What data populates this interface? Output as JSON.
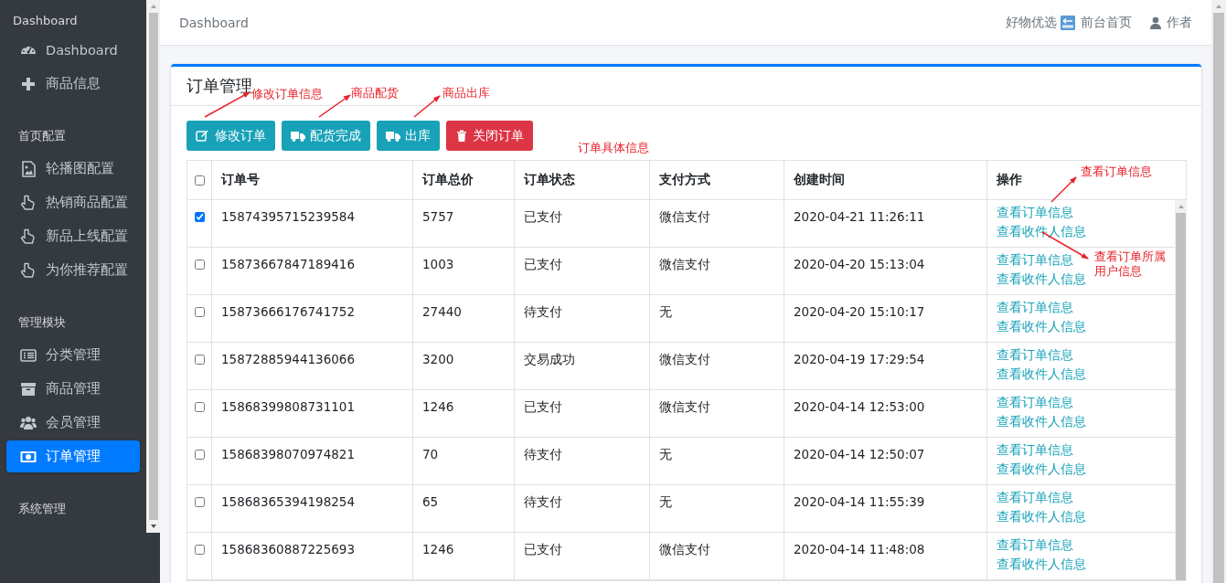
{
  "sidebar": {
    "sections": [
      {
        "title": "Dashboard",
        "items": [
          {
            "label": "Dashboard",
            "kind": "gauge",
            "selected": false
          },
          {
            "label": "商品信息",
            "kind": "plus",
            "selected": false
          }
        ]
      },
      {
        "title": "首页配置",
        "items": [
          {
            "label": "轮播图配置",
            "kind": "image",
            "selected": false
          },
          {
            "label": "热销商品配置",
            "kind": "hand",
            "selected": false
          },
          {
            "label": "新品上线配置",
            "kind": "hand",
            "selected": false
          },
          {
            "label": "为你推荐配置",
            "kind": "hand",
            "selected": false
          }
        ]
      },
      {
        "title": "管理模块",
        "items": [
          {
            "label": "分类管理",
            "kind": "list",
            "selected": false
          },
          {
            "label": "商品管理",
            "kind": "archive",
            "selected": false
          },
          {
            "label": "会员管理",
            "kind": "users",
            "selected": false
          },
          {
            "label": "订单管理",
            "kind": "money",
            "selected": true
          }
        ]
      },
      {
        "title": "系统管理"
      }
    ]
  },
  "topbar": {
    "title": "Dashboard",
    "links": [
      {
        "label": "好物优选",
        "kind": "plain"
      },
      {
        "label": "前台首页",
        "kind": "back"
      },
      {
        "label": "作者",
        "kind": "user"
      }
    ]
  },
  "card": {
    "title": "订单管理",
    "buttons": [
      {
        "label": "修改订单",
        "kind": "edit"
      },
      {
        "label": "配货完成",
        "kind": "truck"
      },
      {
        "label": "出库",
        "kind": "truck"
      },
      {
        "label": "关闭订单",
        "kind": "trash"
      }
    ]
  },
  "table": {
    "select_all": {
      "checked": false
    },
    "columns": [
      "订单号",
      "订单总价",
      "订单状态",
      "支付方式",
      "创建时间",
      "操作"
    ],
    "rows": [
      {
        "checked": true,
        "cells": [
          "15874395715239584",
          "5757",
          "已支付",
          "微信支付",
          "2020-04-21 11:26:11"
        ],
        "actions": [
          "查看订单信息",
          "查看收件人信息"
        ]
      },
      {
        "checked": false,
        "cells": [
          "15873667847189416",
          "1003",
          "已支付",
          "微信支付",
          "2020-04-20 15:13:04"
        ],
        "actions": [
          "查看订单信息",
          "查看收件人信息"
        ]
      },
      {
        "checked": false,
        "cells": [
          "15873666176741752",
          "27440",
          "待支付",
          "无",
          "2020-04-20 15:10:17"
        ],
        "actions": [
          "查看订单信息",
          "查看收件人信息"
        ]
      },
      {
        "checked": false,
        "cells": [
          "15872885944136066",
          "3200",
          "交易成功",
          "微信支付",
          "2020-04-19 17:29:54"
        ],
        "actions": [
          "查看订单信息",
          "查看收件人信息"
        ]
      },
      {
        "checked": false,
        "cells": [
          "15868399808731101",
          "1246",
          "已支付",
          "微信支付",
          "2020-04-14 12:53:00"
        ],
        "actions": [
          "查看订单信息",
          "查看收件人信息"
        ]
      },
      {
        "checked": false,
        "cells": [
          "15868398070974821",
          "70",
          "待支付",
          "无",
          "2020-04-14 12:50:07"
        ],
        "actions": [
          "查看订单信息",
          "查看收件人信息"
        ]
      },
      {
        "checked": false,
        "cells": [
          "15868365394198254",
          "65",
          "待支付",
          "无",
          "2020-04-14 11:55:39"
        ],
        "actions": [
          "查看订单信息",
          "查看收件人信息"
        ]
      },
      {
        "checked": false,
        "cells": [
          "15868360887225693",
          "1246",
          "已支付",
          "微信支付",
          "2020-04-14 11:48:08"
        ],
        "actions": [
          "查看订单信息",
          "查看收件人信息"
        ]
      }
    ]
  },
  "annotations": [
    {
      "text": "修改订单信息",
      "kind": "arrow"
    },
    {
      "text": "商品配货",
      "kind": "arrow"
    },
    {
      "text": "商品出库",
      "kind": "arrow"
    },
    {
      "text": "订单具体信息",
      "kind": "label"
    },
    {
      "text": "查看订单信息",
      "kind": "arrow"
    },
    {
      "text": "查看订单所属用户信息",
      "kind": "arrow"
    }
  ]
}
